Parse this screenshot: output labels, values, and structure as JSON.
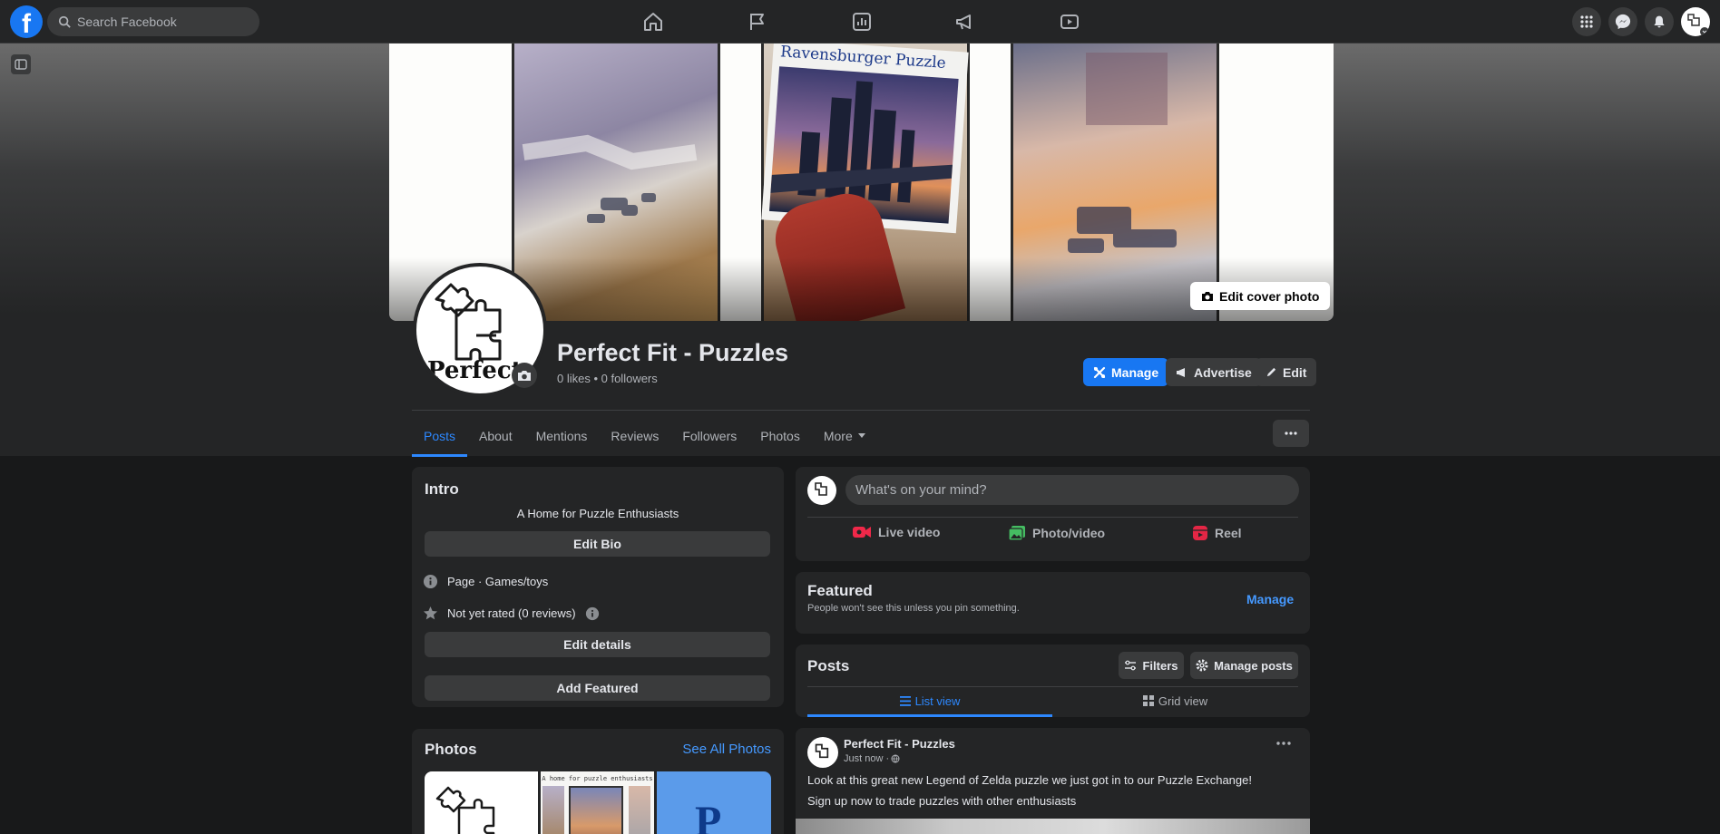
{
  "topbar": {
    "search_placeholder": "Search Facebook",
    "logo_letter": "f"
  },
  "cover": {
    "edit_cover_label": "Edit cover photo",
    "puzzle_box_text": "Ravensburger Puzzle"
  },
  "profile": {
    "logo_text": "Perfect",
    "name": "Perfect Fit - Puzzles",
    "stats": "0 likes • 0 followers"
  },
  "header_buttons": {
    "manage": "Manage",
    "advertise": "Advertise",
    "edit": "Edit"
  },
  "tabs": [
    {
      "label": "Posts"
    },
    {
      "label": "About"
    },
    {
      "label": "Mentions"
    },
    {
      "label": "Reviews"
    },
    {
      "label": "Followers"
    },
    {
      "label": "Photos"
    },
    {
      "label": "More"
    }
  ],
  "intro": {
    "title": "Intro",
    "bio": "A Home for Puzzle Enthusiasts",
    "edit_bio": "Edit Bio",
    "category": "Page · Games/toys",
    "rating": "Not yet rated (0 reviews)",
    "edit_details": "Edit details",
    "add_featured": "Add Featured"
  },
  "photos": {
    "title": "Photos",
    "see_all": "See All Photos",
    "thumb2_caption": "A home for puzzle enthusiasts",
    "thumb3_letter": "P"
  },
  "composer": {
    "placeholder": "What's on your mind?",
    "live_video": "Live video",
    "photo_video": "Photo/video",
    "reel": "Reel"
  },
  "featured": {
    "title": "Featured",
    "subtitle": "People won't see this unless you pin something.",
    "manage": "Manage"
  },
  "posts_section": {
    "title": "Posts",
    "filters": "Filters",
    "manage_posts": "Manage posts",
    "list_view": "List view",
    "grid_view": "Grid view"
  },
  "post": {
    "author": "Perfect Fit - Puzzles",
    "time": "Just now · ",
    "line1": "Look at this great new Legend of Zelda puzzle we just got in to our Puzzle Exchange!",
    "line2": "Sign up now to trade puzzles with other enthusiasts"
  },
  "colors": {
    "accent": "#1877f2",
    "link": "#2d88ff",
    "background": "#18191a",
    "card": "#242526"
  }
}
